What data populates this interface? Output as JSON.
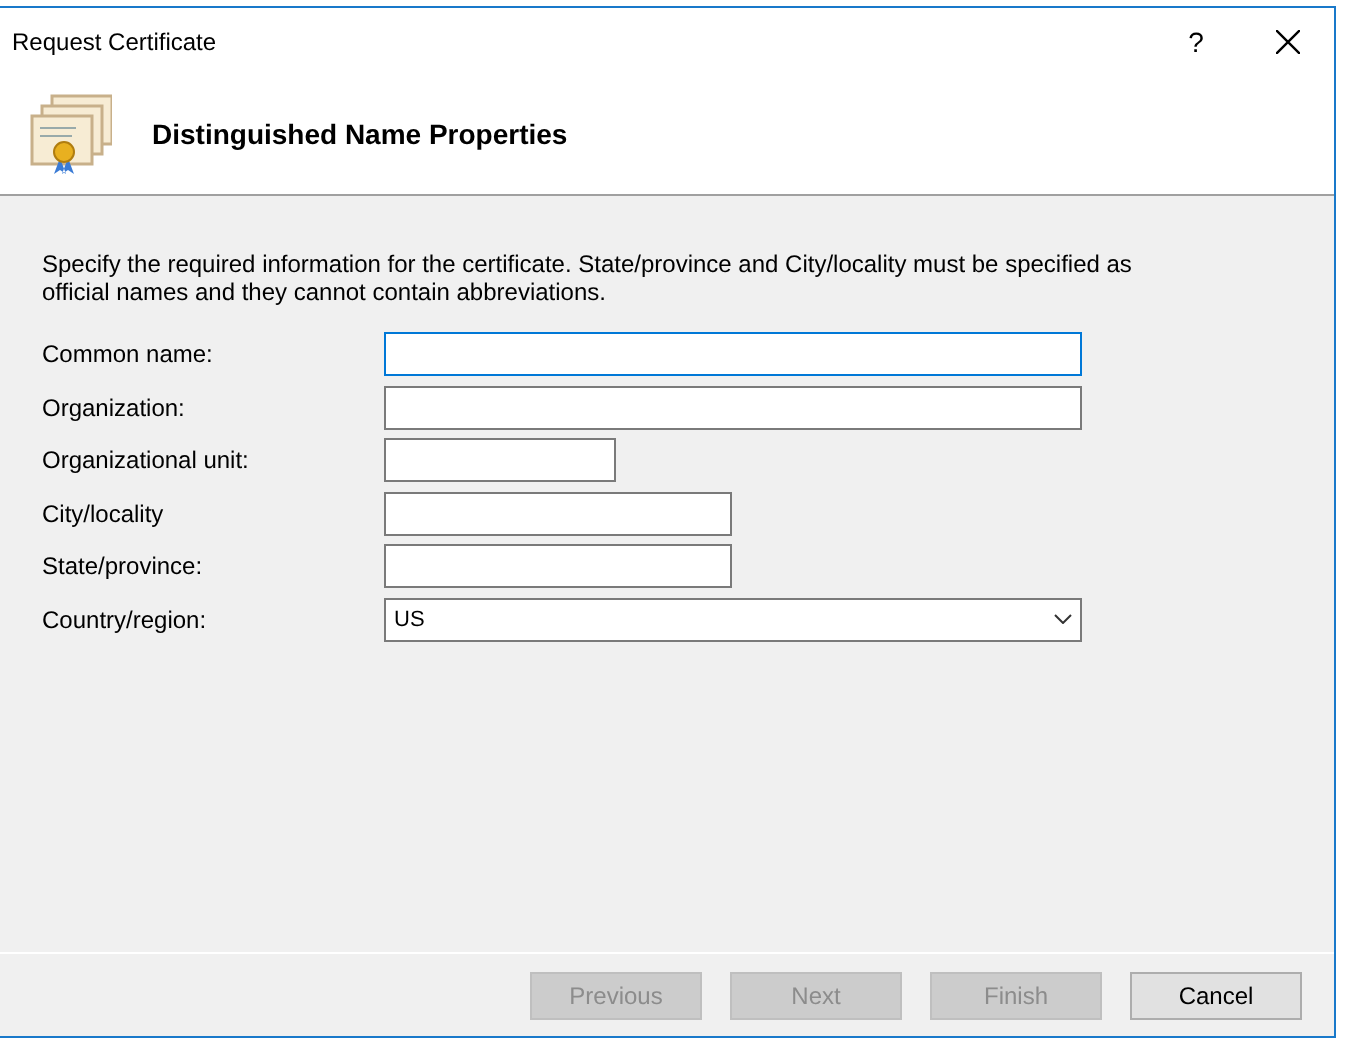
{
  "window": {
    "title": "Request Certificate",
    "help": "?"
  },
  "header": {
    "title": "Distinguished Name Properties"
  },
  "intro": "Specify the required information for the certificate. State/province and City/locality must be specified as official names and they cannot contain abbreviations.",
  "fields": [
    {
      "label": "Common name:",
      "kind": "text",
      "focused": true
    },
    {
      "label": "Organization:",
      "kind": "text",
      "focused": false
    },
    {
      "label": "Organizational unit:",
      "kind": "text",
      "focused": false
    },
    {
      "label": "City/locality",
      "kind": "text",
      "focused": false
    },
    {
      "label": "State/province:",
      "kind": "text",
      "focused": false
    },
    {
      "label": "Country/region:",
      "kind": "select",
      "focused": false,
      "value": "US"
    }
  ],
  "buttons": [
    {
      "label": "Previous",
      "disabled": true
    },
    {
      "label": "Next",
      "disabled": true
    },
    {
      "label": "Finish",
      "disabled": true
    },
    {
      "label": "Cancel",
      "disabled": false
    }
  ]
}
